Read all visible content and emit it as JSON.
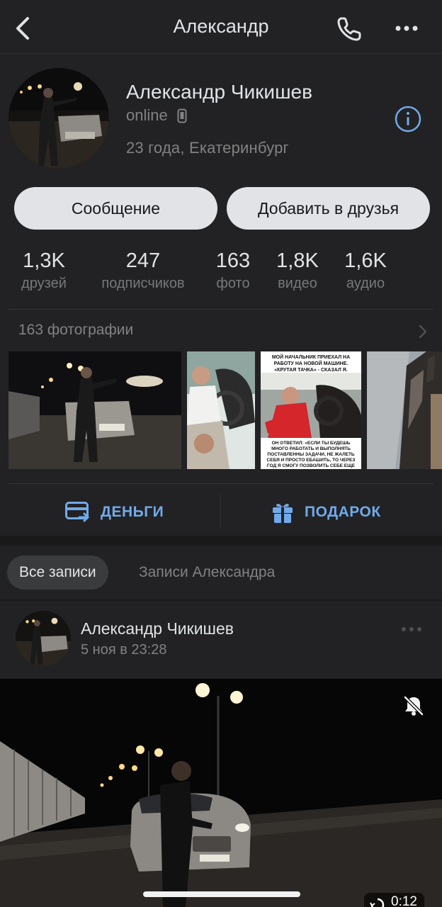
{
  "header": {
    "title": "Александр",
    "back_icon": "chevron-left-icon",
    "call_icon": "phone-icon",
    "more_icon": "more-horizontal-icon"
  },
  "profile": {
    "name": "Александр Чикишев",
    "status": "online",
    "location": "23 года, Екатеринбург",
    "message_button": "Сообщение",
    "add_friend_button": "Добавить в друзья"
  },
  "stats": [
    {
      "value": "1,3K",
      "label": "друзей"
    },
    {
      "value": "247",
      "label": "подписчиков"
    },
    {
      "value": "163",
      "label": "фото"
    },
    {
      "value": "1,8K",
      "label": "видео"
    },
    {
      "value": "1,6K",
      "label": "аудио"
    }
  ],
  "photos": {
    "title": "163 фотографии",
    "meme_top": "МОЙ НАЧАЛЬНИК ПРИЕХАЛ НА РАБОТУ НА НОВОЙ МАШИНЕ. «КРУТАЯ ТАЧКА» - СКАЗАЛ Я.",
    "meme_bottom": "ОН ОТВЕТИЛ: «ЕСЛИ ТЫ БУДЕШЬ МНОГО РАБОТАТЬ И ВЫПОЛНЯТЬ ПОСТАВЛЕННЫ ЗАДАЧИ, НЕ ЖАЛЕТЬ СЕБЯ И ПРОСТО ЕБАШИТЬ, ТО ЧЕРЕЗ ГОД Я СМОГУ ПОЗВОЛИТЬ СЕБЕ ЕЩЕ ОДНУ»"
  },
  "actions": {
    "money": "ДЕНЬГИ",
    "gift": "ПОДАРОК"
  },
  "tabs": {
    "all": "Все записи",
    "own": "Записи Александра"
  },
  "post": {
    "author": "Александр Чикишев",
    "date": "5 ноя в 23:28",
    "duration": "0:12"
  },
  "colors": {
    "accent": "#71aaeb",
    "background": "#19191a",
    "card": "#222224"
  }
}
